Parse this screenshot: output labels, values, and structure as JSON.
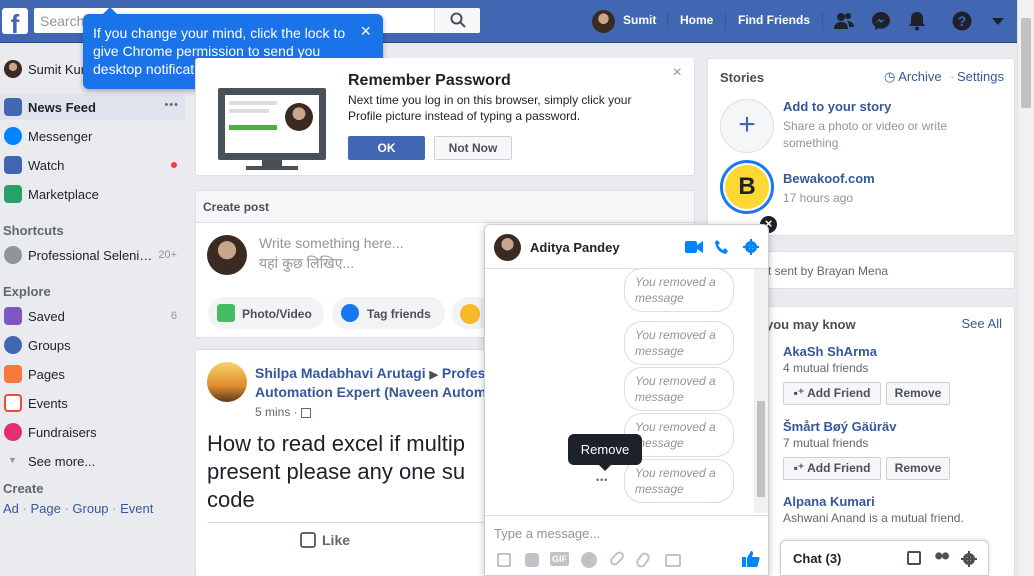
{
  "topbar": {
    "logo": "f",
    "search_placeholder": "Search",
    "user_name": "Sumit",
    "home": "Home",
    "find_friends": "Find Friends"
  },
  "popup": {
    "text": "If you change your mind, click the lock to give Chrome permission to send you desktop notifications.",
    "close": "×"
  },
  "sidebar": {
    "profile_name": "Sumit Kum",
    "items": [
      {
        "label": "News Feed",
        "extra": "•••",
        "icon": "news-feed-icon",
        "color": "#4267b2"
      },
      {
        "label": "Messenger",
        "extra": "",
        "icon": "messenger-icon",
        "color": "#0084ff"
      },
      {
        "label": "Watch",
        "extra": "•",
        "icon": "watch-icon",
        "color": "#4267b2"
      },
      {
        "label": "Marketplace",
        "extra": "",
        "icon": "marketplace-icon",
        "color": "#26a269"
      }
    ],
    "shortcuts_heading": "Shortcuts",
    "shortcuts": [
      {
        "label": "Professional Seleni…",
        "count": "20+"
      }
    ],
    "explore_heading": "Explore",
    "explore": [
      {
        "label": "Saved",
        "count": "6",
        "icon": "saved-icon",
        "color": "#7e57c2"
      },
      {
        "label": "Groups",
        "count": "",
        "icon": "groups-icon",
        "color": "#4267b2"
      },
      {
        "label": "Pages",
        "count": "",
        "icon": "pages-icon",
        "color": "#f5793a"
      },
      {
        "label": "Events",
        "count": "",
        "icon": "events-icon",
        "color": "#e94b3c"
      },
      {
        "label": "Fundraisers",
        "count": "",
        "icon": "fundraisers-icon",
        "color": "#e1306c"
      }
    ],
    "see_more": "See more...",
    "create_heading": "Create",
    "create_links": [
      "Ad",
      "Page",
      "Group",
      "Event"
    ]
  },
  "remember": {
    "title": "Remember Password",
    "body": "Next time you log in on this browser, simply click your Profile picture instead of typing a password.",
    "ok": "OK",
    "not_now": "Not Now",
    "close": "×"
  },
  "create_post": {
    "title": "Create post",
    "placeholder_en": "Write something here...",
    "placeholder_hi": "यहां कुछ लिखिए...",
    "buttons": [
      "Photo/Video",
      "Tag friends"
    ]
  },
  "post": {
    "author": "Shilpa Madabhavi Arutagi",
    "group_prefix": "Profes",
    "group_line2": "Automation Expert (Naveen Autom",
    "time": "5 mins",
    "text_lines": [
      "How to read excel if multip",
      "present please any one su",
      "code"
    ],
    "like": "Like"
  },
  "chat_window": {
    "name": "Aditya Pandey",
    "messages": [
      "You removed a message",
      "You removed a message",
      "You removed a message",
      "You removed a message",
      "You removed a message"
    ],
    "tooltip": "Remove",
    "more": "•••",
    "input_placeholder": "Type a message..."
  },
  "stories": {
    "heading": "Stories",
    "archive": "Archive",
    "settings": "Settings",
    "add_title": "Add to your story",
    "add_sub": "Share a photo or video or write something",
    "story_name": "Bewakoof.com",
    "story_time": "17 hours ago",
    "story_logo": "B"
  },
  "request_line": "t sent by Brayan Mena",
  "people": {
    "heading": "you may know",
    "see_all": "See All",
    "list": [
      {
        "name": "AkaSh ShArma",
        "sub": "4 mutual friends"
      },
      {
        "name": "Šmårt Bøý Gäüräv",
        "sub": "7 mutual friends"
      },
      {
        "name": "Alpana Kumari",
        "sub": "Ashwani Anand is a mutual friend."
      }
    ],
    "add_friend": "Add Friend",
    "remove": "Remove"
  },
  "chat_bar": {
    "label": "Chat (3)"
  }
}
